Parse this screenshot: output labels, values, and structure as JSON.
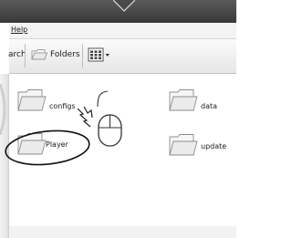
{
  "menubar": {
    "items": [
      {
        "label": "Help"
      }
    ]
  },
  "toolbar": {
    "search_label": "arch",
    "folders_label": "Folders",
    "views_icon": "views-grid-icon",
    "views_dropdown_icon": "chevron-down-icon"
  },
  "folders": [
    {
      "label": "configs",
      "icon": "folder-icon"
    },
    {
      "label": "data",
      "icon": "folder-icon"
    },
    {
      "label": "Player",
      "icon": "folder-icon",
      "highlighted": true
    },
    {
      "label": "update",
      "icon": "folder-icon"
    }
  ],
  "annotations": {
    "click_cursor_icon": "mouse-double-click-icon",
    "highlight_shape": "ellipse"
  },
  "colors": {
    "titlebar": "#3f3f3f",
    "menubar": "#f3f3f3",
    "toolbar": "#e9e9e9",
    "content_background": "#ffffff",
    "highlight_stroke": "#111111"
  }
}
